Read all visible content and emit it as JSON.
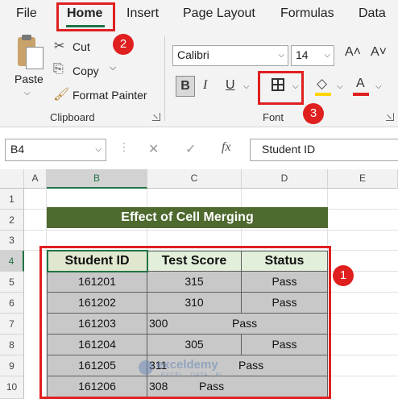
{
  "menu": {
    "tabs": [
      "File",
      "Home",
      "Insert",
      "Page Layout",
      "Formulas",
      "Data"
    ],
    "active": "Home"
  },
  "ribbon": {
    "clipboard": {
      "paste_label": "Paste",
      "cut_label": "Cut",
      "copy_label": "Copy",
      "format_painter_label": "Format Painter",
      "group_label": "Clipboard"
    },
    "font": {
      "font_name": "Calibri",
      "font_size": "14",
      "bold": "B",
      "italic": "I",
      "underline": "U",
      "increase_size": "A˄",
      "decrease_size": "A˅",
      "font_color_letter": "A",
      "font_color": "#e01f1f",
      "fill_color": "#ffd400",
      "group_label": "Font"
    }
  },
  "formula_bar": {
    "cell_ref": "B4",
    "cancel": "✕",
    "enter": "✓",
    "fx": "fx",
    "content": "Student ID"
  },
  "sheet": {
    "columns": [
      "A",
      "B",
      "C",
      "D",
      "E"
    ],
    "rows": [
      "1",
      "2",
      "3",
      "4",
      "5",
      "6",
      "7",
      "8",
      "9",
      "10"
    ],
    "selected_cell": "B4",
    "title": "Effect of Cell Merging",
    "headers": [
      "Student ID",
      "Test Score",
      "Status"
    ],
    "records": [
      {
        "id": "161201",
        "score": "315",
        "status": "Pass"
      },
      {
        "id": "161202",
        "score": "310",
        "status": "Pass"
      },
      {
        "id": "161203",
        "score": "300",
        "status": "Pass"
      },
      {
        "id": "161204",
        "score": "305",
        "status": "Pass"
      },
      {
        "id": "161205",
        "score": "311",
        "status": "Pass"
      },
      {
        "id": "161206",
        "score": "308",
        "status": "Pass"
      }
    ]
  },
  "annotations": {
    "markers": [
      "1",
      "2",
      "3"
    ],
    "color": "#e01f1f"
  },
  "watermark": {
    "name": "exceldemy",
    "tagline": "EXCEL · DATA · BI"
  },
  "colors": {
    "accent": "#217346",
    "title_fill": "#4e6a2e",
    "header_fill": "#e2efda",
    "data_fill": "#c8c8c8"
  }
}
